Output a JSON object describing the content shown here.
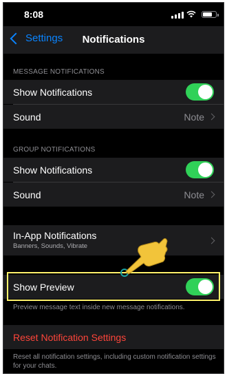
{
  "status_bar": {
    "time": "8:08"
  },
  "nav": {
    "back_label": "Settings",
    "title": "Notifications"
  },
  "message_notifications": {
    "header": "MESSAGE NOTIFICATIONS",
    "show_notifications_label": "Show Notifications",
    "show_notifications_on": true,
    "sound_label": "Sound",
    "sound_value": "Note"
  },
  "group_notifications": {
    "header": "GROUP NOTIFICATIONS",
    "show_notifications_label": "Show Notifications",
    "show_notifications_on": true,
    "sound_label": "Sound",
    "sound_value": "Note"
  },
  "in_app": {
    "label": "In-App Notifications",
    "subtitle": "Banners, Sounds, Vibrate"
  },
  "show_preview": {
    "label": "Show Preview",
    "on": true,
    "footer": "Preview message text inside new message notifications."
  },
  "reset": {
    "label": "Reset Notification Settings",
    "footer": "Reset all notification settings, including custom notification settings for your chats."
  },
  "colors": {
    "background": "#000000",
    "cell": "#1c1c1e",
    "accent_blue": "#0a84ff",
    "toggle_on": "#30d158",
    "destructive": "#ff453a",
    "highlight": "#fff36b"
  },
  "icons": [
    "back-chevron-icon",
    "signal-icon",
    "wifi-icon",
    "battery-icon",
    "chevron-right-icon",
    "pointing-hand-icon"
  ]
}
